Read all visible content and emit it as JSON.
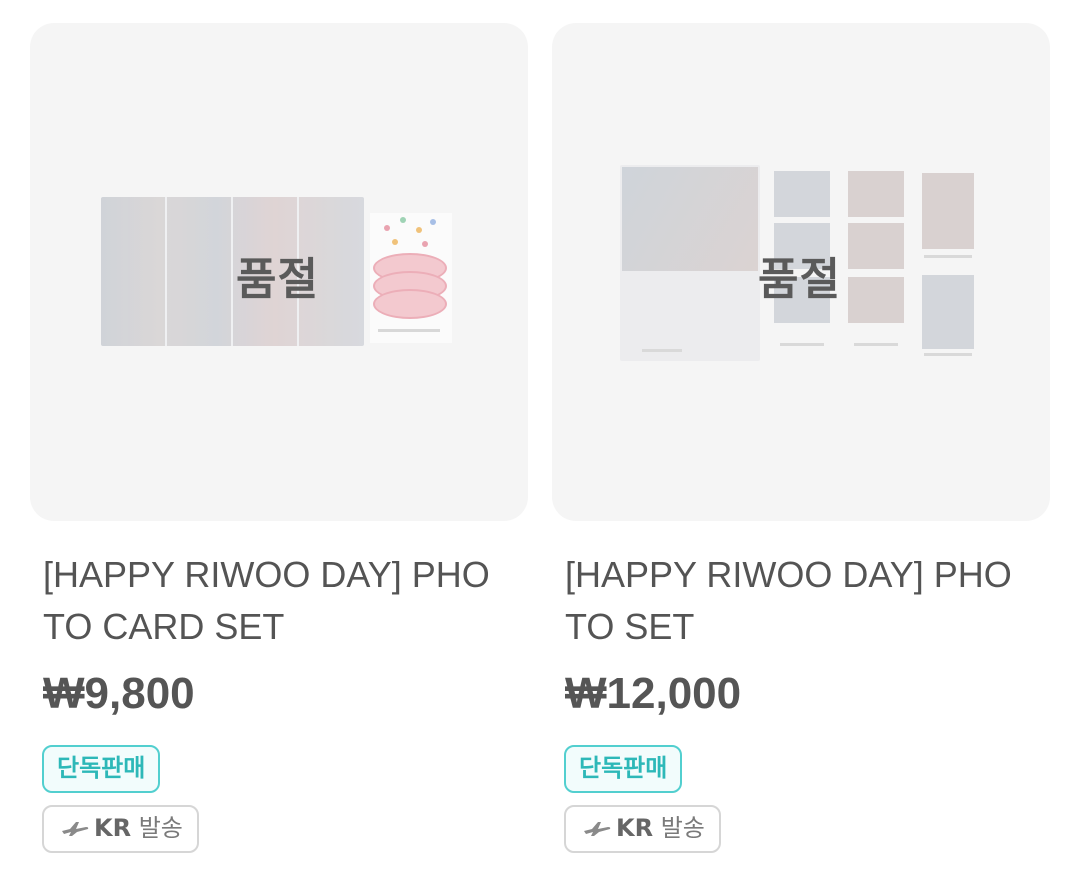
{
  "products": [
    {
      "sold_out_label": "품절",
      "title": "[HAPPY RIWOO DAY] PHOTO CARD SET",
      "price": "₩9,800",
      "badge_exclusive": "단독판매",
      "badge_ship_code": "KR",
      "badge_ship_text": "발송"
    },
    {
      "sold_out_label": "품절",
      "title": "[HAPPY RIWOO DAY] PHOTO SET",
      "price": "₩12,000",
      "badge_exclusive": "단독판매",
      "badge_ship_code": "KR",
      "badge_ship_text": "발송"
    }
  ],
  "colors": {
    "thumb_bg": "#f5f5f5",
    "exclusive_accent": "#2db8b8",
    "text_primary": "#545454"
  },
  "icons": {
    "ship": "airplane-icon"
  }
}
